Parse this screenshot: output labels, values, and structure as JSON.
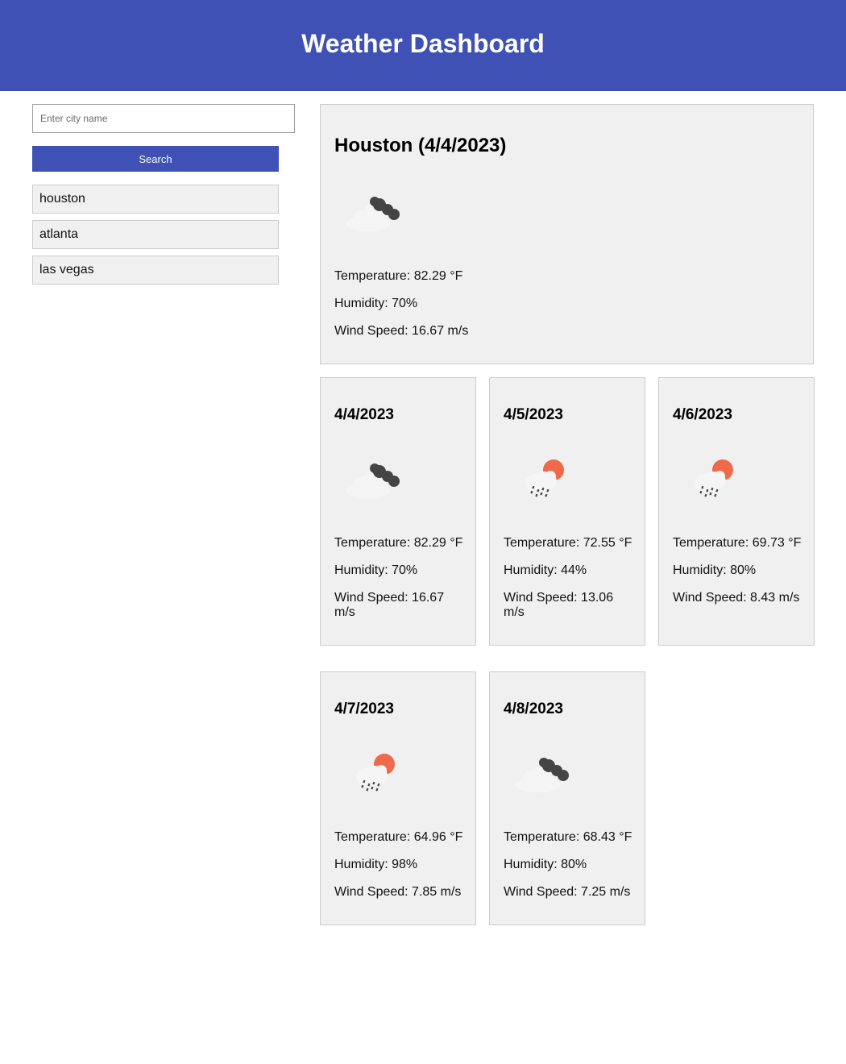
{
  "header": {
    "title": "Weather Dashboard"
  },
  "search": {
    "placeholder": "Enter city name",
    "button_label": "Search"
  },
  "history": [
    "houston",
    "atlanta",
    "las vegas"
  ],
  "current": {
    "title": "Houston (4/4/2023)",
    "icon": "cloudy-night-icon",
    "temperature": "Temperature: 82.29 °F",
    "humidity": "Humidity: 70%",
    "wind": "Wind Speed: 16.67 m/s"
  },
  "forecast": [
    {
      "date": "4/4/2023",
      "icon": "cloudy-night-icon",
      "temperature": "Temperature: 82.29 °F",
      "humidity": "Humidity: 70%",
      "wind": "Wind Speed: 16.67 m/s"
    },
    {
      "date": "4/5/2023",
      "icon": "sun-rain-icon",
      "temperature": "Temperature: 72.55 °F",
      "humidity": "Humidity: 44%",
      "wind": "Wind Speed: 13.06 m/s"
    },
    {
      "date": "4/6/2023",
      "icon": "sun-rain-icon",
      "temperature": "Temperature: 69.73 °F",
      "humidity": "Humidity: 80%",
      "wind": "Wind Speed: 8.43 m/s"
    },
    {
      "date": "4/7/2023",
      "icon": "sun-rain-icon",
      "temperature": "Temperature: 64.96 °F",
      "humidity": "Humidity: 98%",
      "wind": "Wind Speed: 7.85 m/s"
    },
    {
      "date": "4/8/2023",
      "icon": "cloudy-night-icon",
      "temperature": "Temperature: 68.43 °F",
      "humidity": "Humidity: 80%",
      "wind": "Wind Speed: 7.25 m/s"
    }
  ],
  "colors": {
    "accent": "#3f51b5",
    "card_bg": "#f0f0f0",
    "sun": "#ef6a4a",
    "cloud_dark": "#444444"
  }
}
